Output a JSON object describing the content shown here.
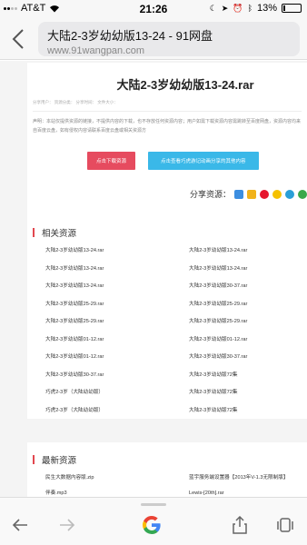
{
  "status": {
    "carrier": "AT&T",
    "time": "21:26",
    "battery_pct": "13%",
    "battery_level": 0.13
  },
  "browser": {
    "page_title": "大陆2-3岁幼幼版13-24 - 91网盘",
    "url": "www.91wangpan.com"
  },
  "file": {
    "title": "大陆2-3岁幼幼版13-24.rar",
    "meta": "分享用户：  资源分类：  分享时间：  文件大小：",
    "notice": "声明：本站仅提供资源的链接，不提供内容的下载，也不存放任何资源内容；用户如需下载资源内容需跳转至百度网盘，资源内容均来自百度云盘，如有侵权内容请联系百度云盘或相关资源方",
    "download_btn": "点击下载资源",
    "more_btn": "点击查看巧虎游记动画分享的其他内容"
  },
  "share": {
    "label": "分享资源："
  },
  "related": {
    "title": "相关资源",
    "items": [
      "大陆2-3岁幼幼版13-24.rar",
      "大陆2-3岁幼幼版13-24.rar",
      "大陆2-3岁幼幼版13-24.rar",
      "大陆2-3岁幼幼版13-24.rar",
      "大陆2-3岁幼幼版13-24.rar",
      "大陆2-3岁幼幼版30-37.rar",
      "大陆2-3岁幼幼版25-29.rar",
      "大陆2-3岁幼幼版25-29.rar",
      "大陆2-3岁幼幼版25-29.rar",
      "大陆2-3岁幼幼版25-29.rar",
      "大陆2-3岁幼幼版01-12.rar",
      "大陆2-3岁幼幼版01-12.rar",
      "大陆2-3岁幼幼版01-12.rar",
      "大陆2-3岁幼幼版30-37.rar",
      "大陆2-3岁幼幼版30-37.rar",
      "大陆2-3岁幼幼版72集",
      "巧虎2-3岁（大陆幼幼版）",
      "大陆2-3岁幼幼版72集",
      "巧虎2-3岁（大陆幼幼版）",
      "大陆2-3岁幼幼版72集"
    ]
  },
  "latest": {
    "title": "最新资源",
    "items": [
      "民生大数据内容版.zip",
      "蓝宇服务端设置器【2013年V-1.3无限制版】",
      "伴奏.mp3",
      "Lewis-[20th].rar"
    ]
  },
  "colors": {
    "accent_red": "#e64b5f",
    "accent_blue": "#3ab8e8"
  }
}
